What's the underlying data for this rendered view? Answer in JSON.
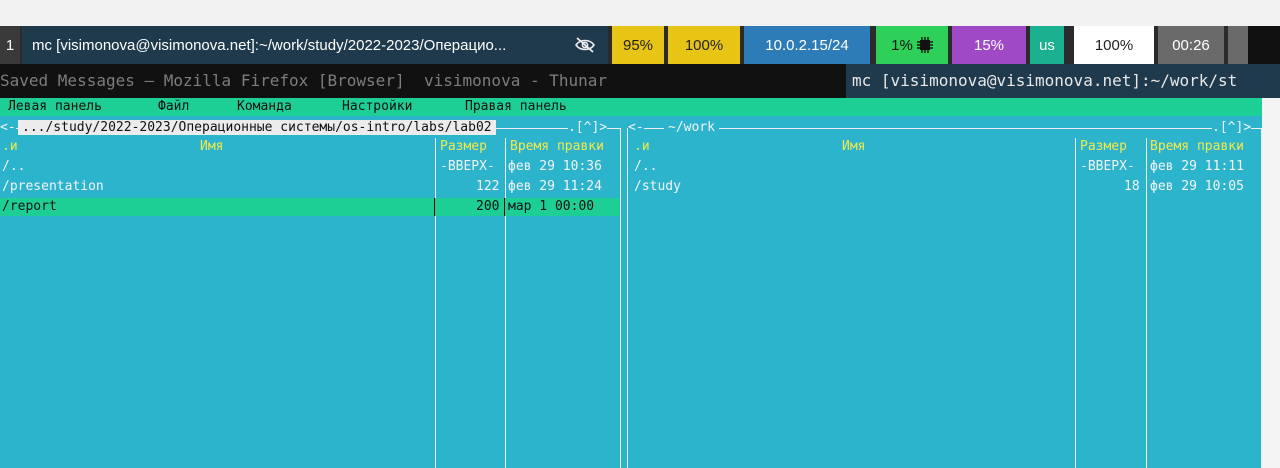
{
  "taskbar": {
    "workspace": "1",
    "window_title": "mc [visimonova@visimonova.net]:~/work/study/2022-2023/Операцио...",
    "battery": "95%",
    "volume": "100%",
    "network": "10.0.2.15/24",
    "cpu": "1%",
    "memory": "15%",
    "keyboard": "us",
    "brightness": "100%",
    "time": "00:26",
    "colors": {
      "battery": "#e8c515",
      "network": "#2d7cb7",
      "cpu": "#2fd05a",
      "memory": "#a049c7",
      "keyboard": "#1bb08f"
    }
  },
  "window_tabs": {
    "firefox": "Saved Messages — Mozilla Firefox [Browser]",
    "thunar": "visimonova - Thunar",
    "mc": "mc [visimonova@visimonova.net]:~/work/st"
  },
  "mc": {
    "menu": [
      "Левая панель",
      "Файл",
      "Команда",
      "Настройки",
      "Правая панель"
    ],
    "left_panel": {
      "path": ".../study/2022-2023/Операционные системы/os-intro/labs/lab02",
      "corner_left": "<-",
      "corner_right": ".[^]>",
      "headers": {
        "sort": ".и",
        "name": "Имя",
        "size": "Размер",
        "mtime": "Время правки"
      },
      "rows": [
        {
          "name": "/..",
          "size": "-ВВЕРХ-",
          "mtime": "фев 29 10:36"
        },
        {
          "name": "/presentation",
          "size": "122",
          "mtime": "фев 29 11:24"
        },
        {
          "name": "/report",
          "size": "200",
          "mtime": "мар  1 00:00"
        }
      ]
    },
    "right_panel": {
      "path": "~/work",
      "corner_left": "<-",
      "corner_right": ".[^]>",
      "headers": {
        "sort": ".и",
        "name": "Имя",
        "size": "Размер",
        "mtime": "Время правки"
      },
      "rows": [
        {
          "name": "/..",
          "size": "-ВВЕРХ-",
          "mtime": "фев 29 11:11"
        },
        {
          "name": "/study",
          "size": "18",
          "mtime": "фев 29 10:05"
        }
      ]
    }
  }
}
